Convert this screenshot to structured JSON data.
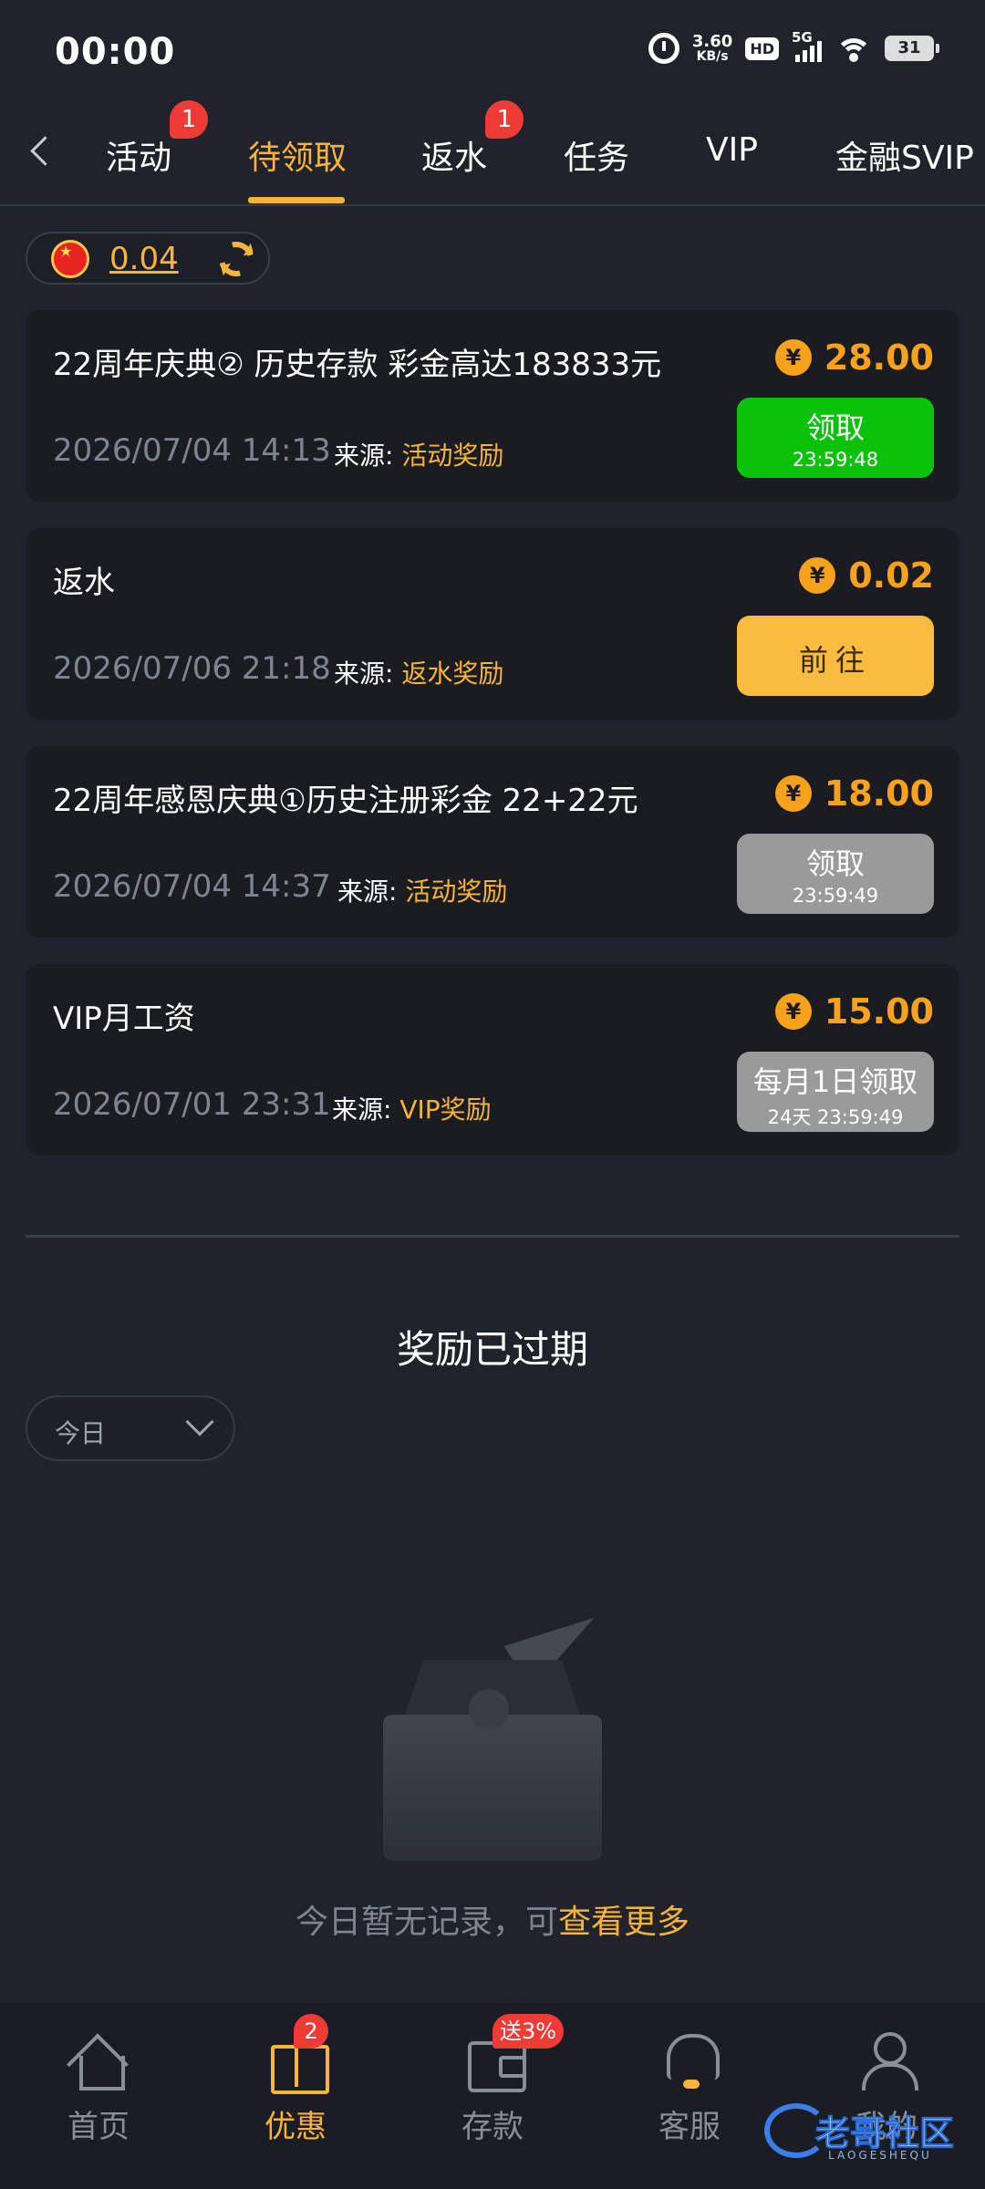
{
  "status_bar": {
    "time": "00:00",
    "net_speed": "3.60",
    "net_unit": "KB/s",
    "hd": "HD",
    "network": "5G",
    "battery": "31"
  },
  "tabs": [
    {
      "label": "活动",
      "badge": "1"
    },
    {
      "label": "待领取",
      "active": true
    },
    {
      "label": "返水",
      "badge": "1"
    },
    {
      "label": "任务"
    },
    {
      "label": "VIP"
    },
    {
      "label": "金融SVIP"
    }
  ],
  "balance": {
    "amount": "0.04"
  },
  "rewards": [
    {
      "title": "22周年庆典② 历史存款 彩金高达183833元",
      "amount": "28.00",
      "date": "2026/07/04 14:13",
      "source_label": "来源:",
      "source": "活动奖励",
      "action": "领取",
      "timer": "23:59:48"
    },
    {
      "title": "返水",
      "amount": "0.02",
      "date": "2026/07/06 21:18",
      "source_label": "来源:",
      "source": "返水奖励",
      "action": "前往"
    },
    {
      "title": "22周年感恩庆典①历史注册彩金 22+22元",
      "amount": "18.00",
      "date": "2026/07/04 14:37",
      "source_label": "来源:",
      "source": "活动奖励",
      "action": "领取",
      "timer": "23:59:49"
    },
    {
      "title": "VIP月工资",
      "amount": "15.00",
      "date": "2026/07/01 23:31",
      "source_label": "来源:",
      "source": "VIP奖励",
      "action": "每月1日领取",
      "timer": "24天 23:59:49"
    }
  ],
  "currency_symbol": "¥",
  "expired": {
    "title": "奖励已过期",
    "filter_value": "今日",
    "empty_text": "今日暂无记录，可",
    "empty_link": "查看更多"
  },
  "bottom_nav": [
    {
      "label": "首页",
      "icon": "home-icon"
    },
    {
      "label": "优惠",
      "icon": "gift-icon",
      "badge": "2",
      "active": true
    },
    {
      "label": "存款",
      "icon": "wallet-icon",
      "badge": "送3%"
    },
    {
      "label": "客服",
      "icon": "headset-icon"
    },
    {
      "label": "我的",
      "icon": "user-icon"
    }
  ],
  "watermark": {
    "text": "老哥社区",
    "sub": "LAOGESHEQU"
  },
  "colors": {
    "accent": "#f7b43a",
    "claim_green": "#0ac20a",
    "go_yellow": "#f9bb40",
    "disabled_gray": "#9a9a9a",
    "badge_red": "#ef3b36"
  }
}
